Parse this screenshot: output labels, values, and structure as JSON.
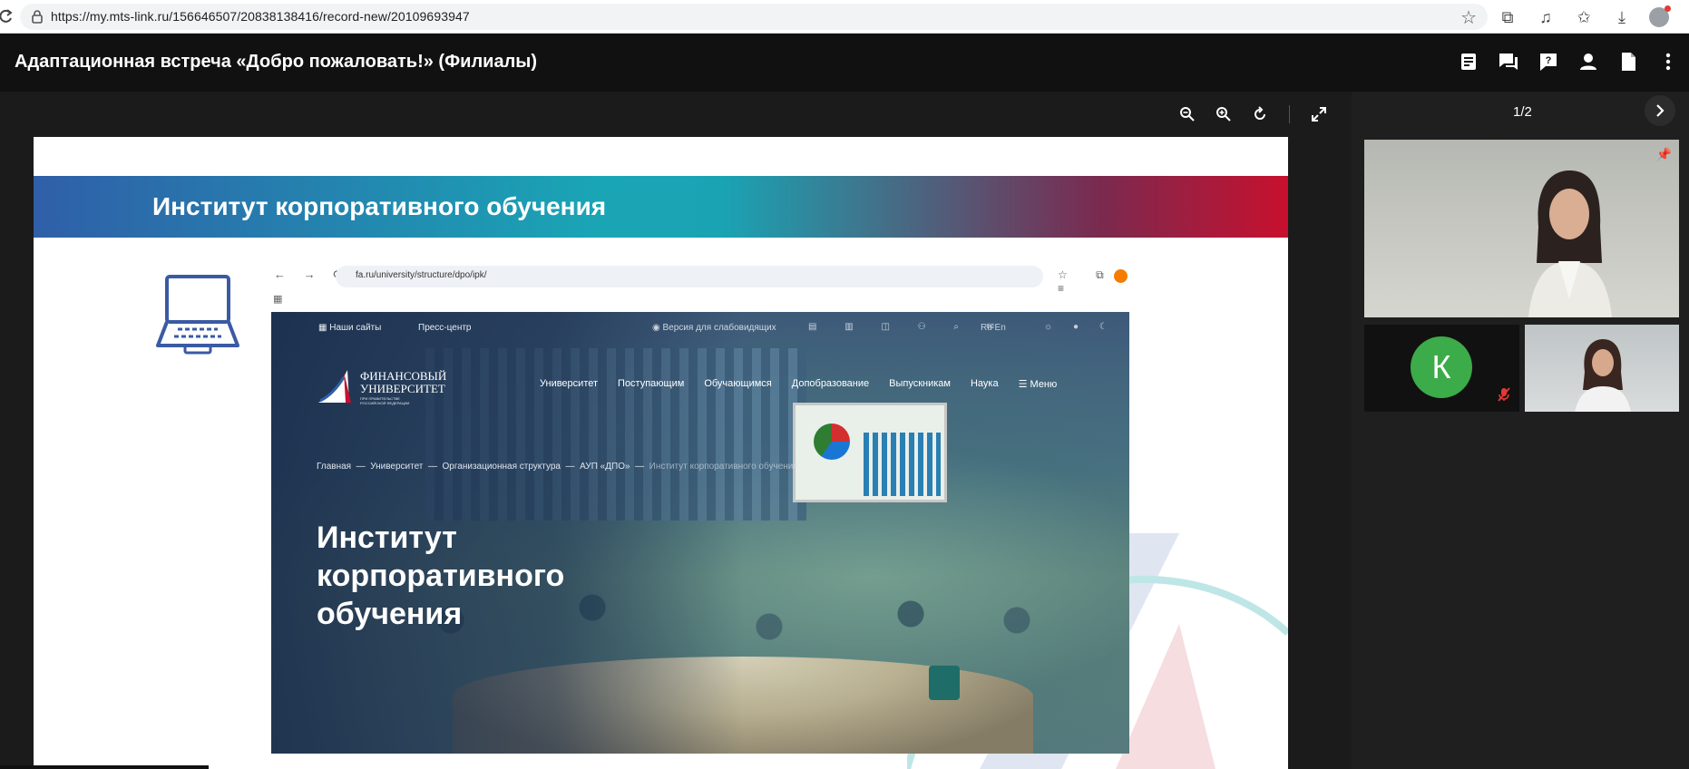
{
  "browser": {
    "url": "https://my.mts-link.ru/156646507/20838138416/record-new/20109693947",
    "icons": [
      "reload-icon",
      "lock-icon",
      "star-icon",
      "extensions-icon",
      "media-icon",
      "favorites-icon",
      "downloads-icon",
      "profile-icon"
    ]
  },
  "header": {
    "title": "Адаптационная встреча «Добро пожаловать!» (Филиалы)",
    "icons": [
      "notes-icon",
      "chat-icon",
      "question-icon",
      "participants-icon",
      "document-icon",
      "more-icon"
    ]
  },
  "stage": {
    "tools": [
      "zoom-out-icon",
      "zoom-in-icon",
      "rotate-icon",
      "fullscreen-icon"
    ]
  },
  "slide": {
    "banner_title": "Институт корпоративного обучения",
    "mini_browser": {
      "address": "fa.ru/university/structure/dpo/ipk/"
    },
    "website": {
      "top_links": [
        "Наши сайты",
        "Пресс-центр",
        "Версия для слабовидящих"
      ],
      "languages": "Ru   En",
      "logo_line1": "ФИНАНСОВЫЙ",
      "logo_line2": "УНИВЕРСИТЕТ",
      "logo_sub": "ПРИ ПРАВИТЕЛЬСТВЕ РОССИЙСКОЙ ФЕДЕРАЦИИ",
      "nav": [
        "Университет",
        "Поступающим",
        "Обучающимся",
        "Допобразование",
        "Выпускникам",
        "Наука",
        "Меню"
      ],
      "breadcrumbs": [
        "Главная",
        "Университет",
        "Организационная структура",
        "АУП «ДПО»",
        "Институт корпоративного обучения"
      ],
      "hero_title": "Институт корпоративного обучения"
    }
  },
  "right_panel": {
    "page_counter": "1/2",
    "tiles": [
      {
        "type": "video",
        "pinned": true
      },
      {
        "type": "avatar",
        "initial": "К",
        "color": "#3cab49",
        "muted": true
      },
      {
        "type": "video"
      }
    ]
  },
  "colors": {
    "app_bg": "#1f1f1f",
    "header_bg": "#111111",
    "avatar_green": "#3cab49",
    "muted_red": "#e53935",
    "banner_blue": "#2f5fa8",
    "banner_teal": "#1aa5b5",
    "banner_red": "#c8102e"
  }
}
